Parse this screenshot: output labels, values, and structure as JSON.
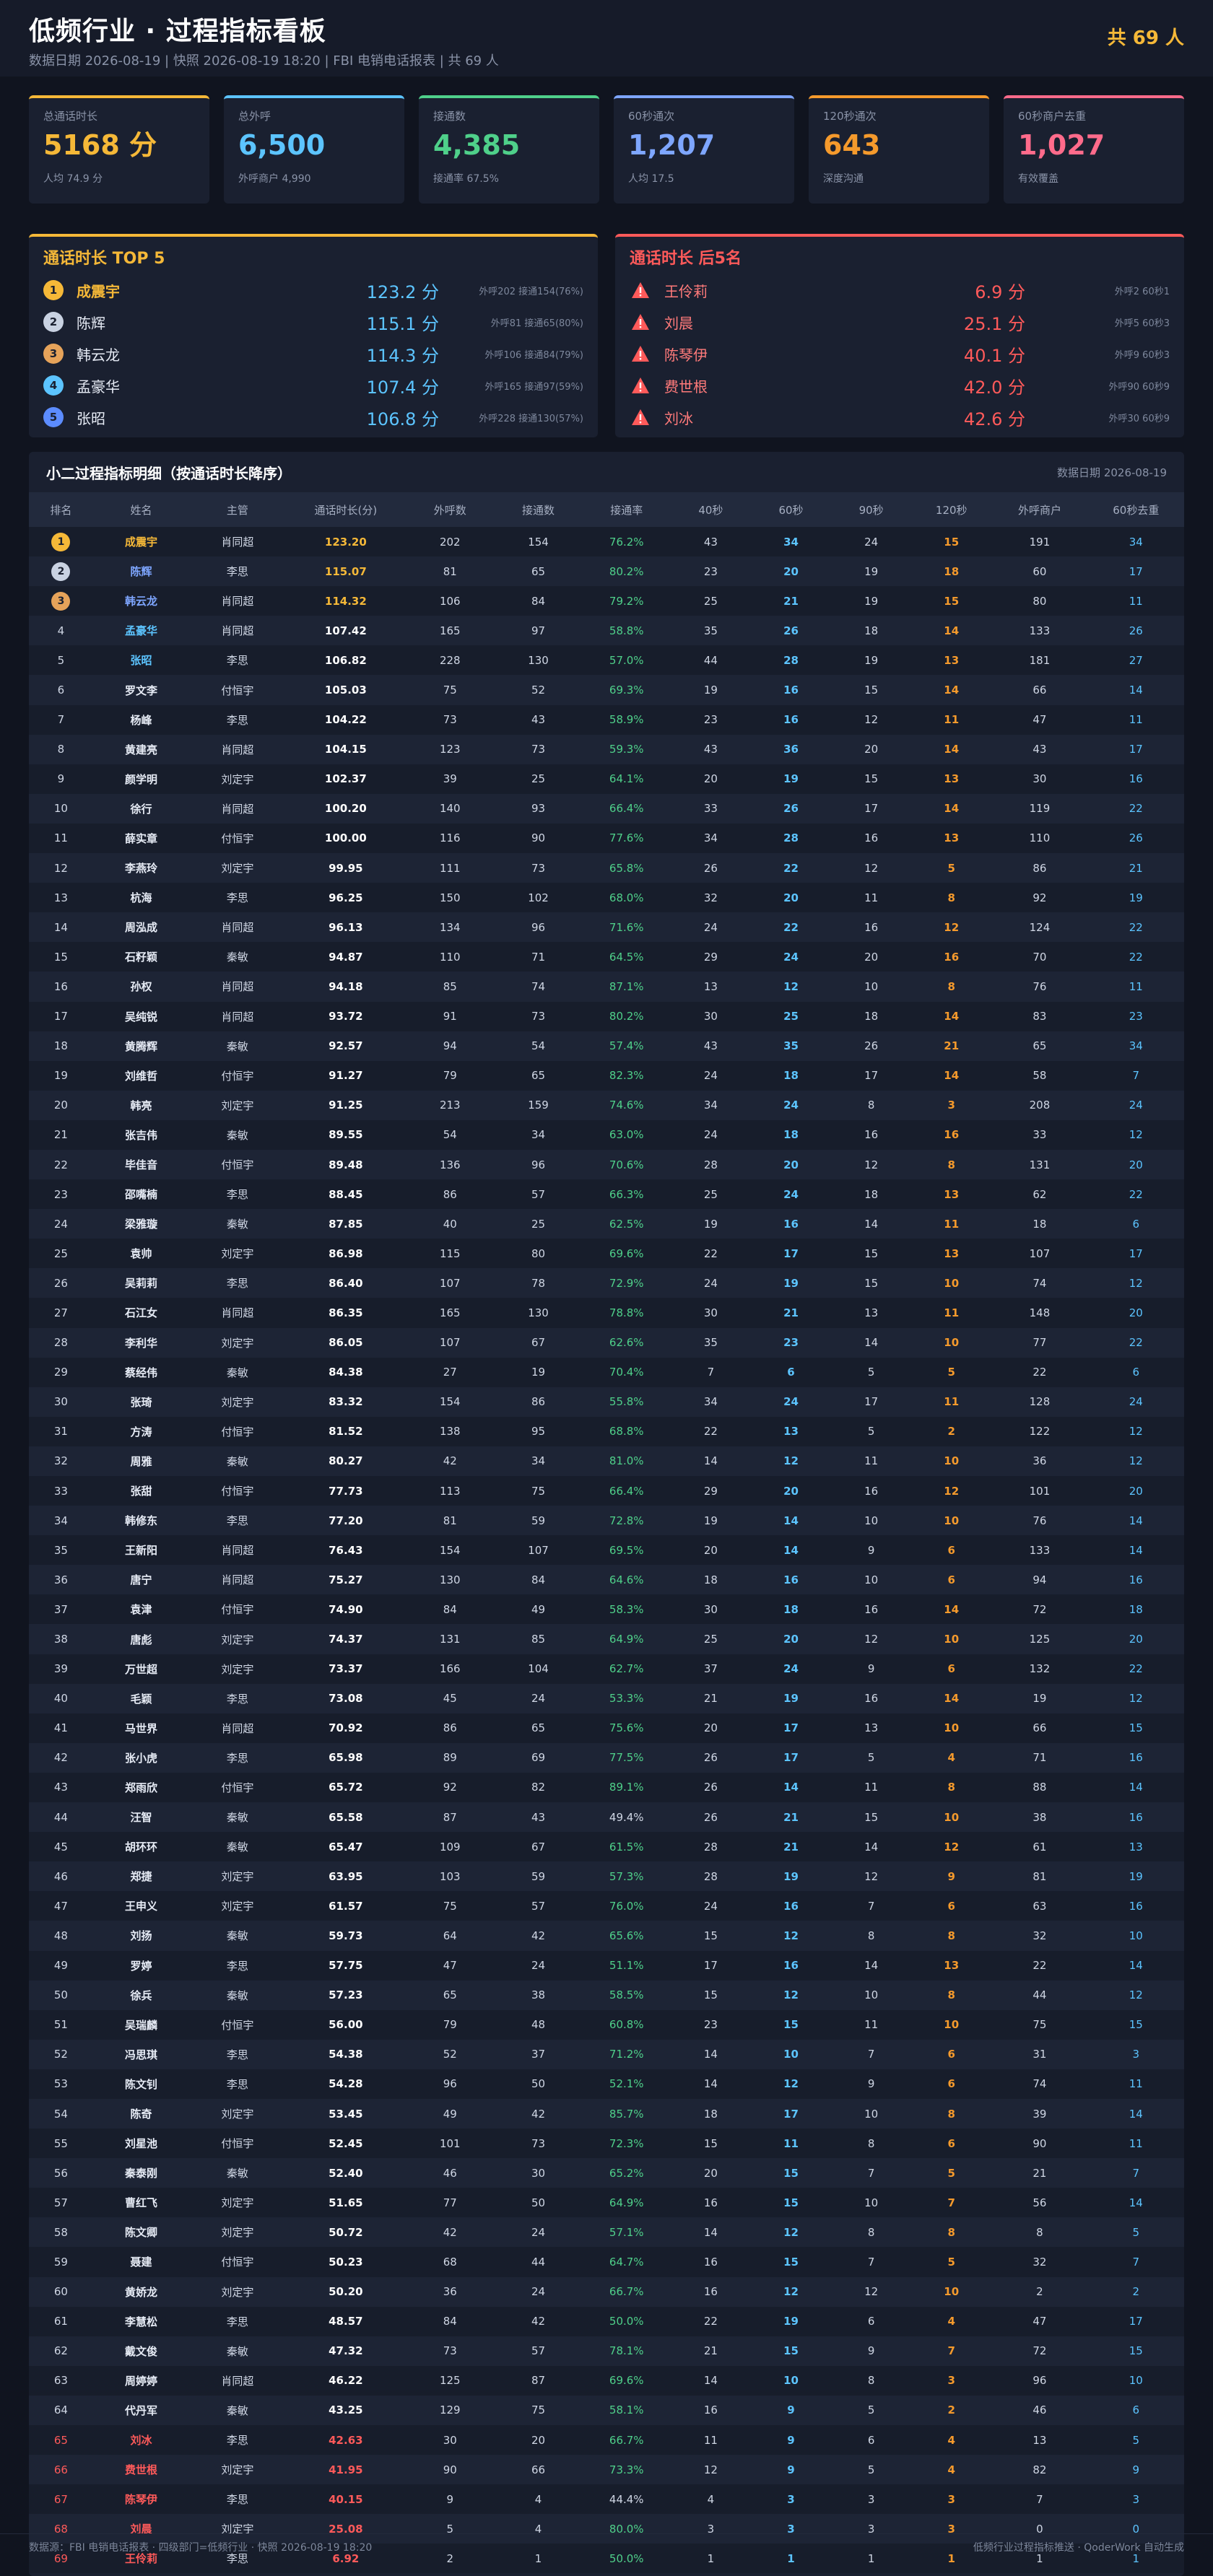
{
  "header": {
    "title": "低频行业 · 过程指标看板",
    "subtitle": "数据日期 2026-08-19 | 快照 2026-08-19 18:20 | FBI 电销电话报表 | 共 69 人",
    "total": "共 69 人"
  },
  "kpis": [
    {
      "label": "总通话时长",
      "value": "5168 分",
      "note": "人均 74.9 分",
      "color": "#f5b838"
    },
    {
      "label": "总外呼",
      "value": "6,500",
      "note": "外呼商户 4,990",
      "color": "#5cc4ff"
    },
    {
      "label": "接通数",
      "value": "4,385",
      "note": "接通率 67.5%",
      "color": "#4fd08a"
    },
    {
      "label": "60秒通次",
      "value": "1,207",
      "note": "人均 17.5",
      "color": "#7ea6ff"
    },
    {
      "label": "120秒通次",
      "value": "643",
      "note": "深度沟通",
      "color": "#f59a2c"
    },
    {
      "label": "60秒商户去重",
      "value": "1,027",
      "note": "有效覆盖",
      "color": "#ff6b8b"
    }
  ],
  "top5": {
    "title": "通话时长 TOP 5",
    "color": "#f5b838",
    "rows": [
      {
        "rank": "1",
        "name": "成震宇",
        "dur": "123.2 分",
        "extra": "外呼202 接通154(76%)",
        "badge": "#f5b838",
        "nameColor": "#f5b838"
      },
      {
        "rank": "2",
        "name": "陈辉",
        "dur": "115.1 分",
        "extra": "外呼81 接通65(80%)",
        "badge": "#c9d2e2",
        "nameColor": "#e6ebf5"
      },
      {
        "rank": "3",
        "name": "韩云龙",
        "dur": "114.3 分",
        "extra": "外呼106 接通84(79%)",
        "badge": "#e6a35a",
        "nameColor": "#e6ebf5"
      },
      {
        "rank": "4",
        "name": "孟豪华",
        "dur": "107.4 分",
        "extra": "外呼165 接通97(59%)",
        "badge": "#5cc4ff",
        "nameColor": "#e6ebf5"
      },
      {
        "rank": "5",
        "name": "张昭",
        "dur": "106.8 分",
        "extra": "外呼228 接通130(57%)",
        "badge": "#5c8cff",
        "nameColor": "#e6ebf5"
      }
    ]
  },
  "bottom5": {
    "title": "通话时长 后5名",
    "color": "#ff5a5a",
    "rows": [
      {
        "name": "王伶莉",
        "dur": "6.9 分",
        "extra": "外呼2 60秒1"
      },
      {
        "name": "刘晨",
        "dur": "25.1 分",
        "extra": "外呼5 60秒3"
      },
      {
        "name": "陈琴伊",
        "dur": "40.1 分",
        "extra": "外呼9 60秒3"
      },
      {
        "name": "费世根",
        "dur": "42.0 分",
        "extra": "外呼90 60秒9"
      },
      {
        "name": "刘冰",
        "dur": "42.6 分",
        "extra": "外呼30 60秒9"
      }
    ]
  },
  "table": {
    "title": "小二过程指标明细（按通话时长降序）",
    "date": "数据日期 2026-08-19",
    "columns": [
      "排名",
      "姓名",
      "主管",
      "通话时长(分)",
      "外呼数",
      "接通数",
      "接通率",
      "40秒",
      "60秒",
      "90秒",
      "120秒",
      "外呼商户",
      "60秒去重"
    ],
    "rows": [
      [
        "1",
        "成震宇",
        "肖同超",
        "123.20",
        "202",
        "154",
        "76.2%",
        "43",
        "34",
        "24",
        "15",
        "191",
        "34"
      ],
      [
        "2",
        "陈辉",
        "李思",
        "115.07",
        "81",
        "65",
        "80.2%",
        "23",
        "20",
        "19",
        "18",
        "60",
        "17"
      ],
      [
        "3",
        "韩云龙",
        "肖同超",
        "114.32",
        "106",
        "84",
        "79.2%",
        "25",
        "21",
        "19",
        "15",
        "80",
        "11"
      ],
      [
        "4",
        "孟豪华",
        "肖同超",
        "107.42",
        "165",
        "97",
        "58.8%",
        "35",
        "26",
        "18",
        "14",
        "133",
        "26"
      ],
      [
        "5",
        "张昭",
        "李思",
        "106.82",
        "228",
        "130",
        "57.0%",
        "44",
        "28",
        "19",
        "13",
        "181",
        "27"
      ],
      [
        "6",
        "罗文李",
        "付恒宇",
        "105.03",
        "75",
        "52",
        "69.3%",
        "19",
        "16",
        "15",
        "14",
        "66",
        "14"
      ],
      [
        "7",
        "杨峰",
        "李思",
        "104.22",
        "73",
        "43",
        "58.9%",
        "23",
        "16",
        "12",
        "11",
        "47",
        "11"
      ],
      [
        "8",
        "黄建亮",
        "肖同超",
        "104.15",
        "123",
        "73",
        "59.3%",
        "43",
        "36",
        "20",
        "14",
        "43",
        "17"
      ],
      [
        "9",
        "颜学明",
        "刘定宇",
        "102.37",
        "39",
        "25",
        "64.1%",
        "20",
        "19",
        "15",
        "13",
        "30",
        "16"
      ],
      [
        "10",
        "徐行",
        "肖同超",
        "100.20",
        "140",
        "93",
        "66.4%",
        "33",
        "26",
        "17",
        "14",
        "119",
        "22"
      ],
      [
        "11",
        "薛实章",
        "付恒宇",
        "100.00",
        "116",
        "90",
        "77.6%",
        "34",
        "28",
        "16",
        "13",
        "110",
        "26"
      ],
      [
        "12",
        "李燕玲",
        "刘定宇",
        "99.95",
        "111",
        "73",
        "65.8%",
        "26",
        "22",
        "12",
        "5",
        "86",
        "21"
      ],
      [
        "13",
        "杭海",
        "李思",
        "96.25",
        "150",
        "102",
        "68.0%",
        "32",
        "20",
        "11",
        "8",
        "92",
        "19"
      ],
      [
        "14",
        "周泓成",
        "肖同超",
        "96.13",
        "134",
        "96",
        "71.6%",
        "24",
        "22",
        "16",
        "12",
        "124",
        "22"
      ],
      [
        "15",
        "石籽颖",
        "秦敏",
        "94.87",
        "110",
        "71",
        "64.5%",
        "29",
        "24",
        "20",
        "16",
        "70",
        "22"
      ],
      [
        "16",
        "孙权",
        "肖同超",
        "94.18",
        "85",
        "74",
        "87.1%",
        "13",
        "12",
        "10",
        "8",
        "76",
        "11"
      ],
      [
        "17",
        "吴纯锐",
        "肖同超",
        "93.72",
        "91",
        "73",
        "80.2%",
        "30",
        "25",
        "18",
        "14",
        "83",
        "23"
      ],
      [
        "18",
        "黄腾辉",
        "秦敏",
        "92.57",
        "94",
        "54",
        "57.4%",
        "43",
        "35",
        "26",
        "21",
        "65",
        "34"
      ],
      [
        "19",
        "刘维哲",
        "付恒宇",
        "91.27",
        "79",
        "65",
        "82.3%",
        "24",
        "18",
        "17",
        "14",
        "58",
        "7"
      ],
      [
        "20",
        "韩亮",
        "刘定宇",
        "91.25",
        "213",
        "159",
        "74.6%",
        "34",
        "24",
        "8",
        "3",
        "208",
        "24"
      ],
      [
        "21",
        "张吉伟",
        "秦敏",
        "89.55",
        "54",
        "34",
        "63.0%",
        "24",
        "18",
        "16",
        "16",
        "33",
        "12"
      ],
      [
        "22",
        "毕佳音",
        "付恒宇",
        "89.48",
        "136",
        "96",
        "70.6%",
        "28",
        "20",
        "12",
        "8",
        "131",
        "20"
      ],
      [
        "23",
        "邵嘴楠",
        "李思",
        "88.45",
        "86",
        "57",
        "66.3%",
        "25",
        "24",
        "18",
        "13",
        "62",
        "22"
      ],
      [
        "24",
        "梁雅璇",
        "秦敏",
        "87.85",
        "40",
        "25",
        "62.5%",
        "19",
        "16",
        "14",
        "11",
        "18",
        "6"
      ],
      [
        "25",
        "袁帅",
        "刘定宇",
        "86.98",
        "115",
        "80",
        "69.6%",
        "22",
        "17",
        "15",
        "13",
        "107",
        "17"
      ],
      [
        "26",
        "吴莉莉",
        "李思",
        "86.40",
        "107",
        "78",
        "72.9%",
        "24",
        "19",
        "15",
        "10",
        "74",
        "12"
      ],
      [
        "27",
        "石江女",
        "肖同超",
        "86.35",
        "165",
        "130",
        "78.8%",
        "30",
        "21",
        "13",
        "11",
        "148",
        "20"
      ],
      [
        "28",
        "李利华",
        "刘定宇",
        "86.05",
        "107",
        "67",
        "62.6%",
        "35",
        "23",
        "14",
        "10",
        "77",
        "22"
      ],
      [
        "29",
        "蔡经伟",
        "秦敏",
        "84.38",
        "27",
        "19",
        "70.4%",
        "7",
        "6",
        "5",
        "5",
        "22",
        "6"
      ],
      [
        "30",
        "张琦",
        "刘定宇",
        "83.32",
        "154",
        "86",
        "55.8%",
        "34",
        "24",
        "17",
        "11",
        "128",
        "24"
      ],
      [
        "31",
        "方涛",
        "付恒宇",
        "81.52",
        "138",
        "95",
        "68.8%",
        "22",
        "13",
        "5",
        "2",
        "122",
        "12"
      ],
      [
        "32",
        "周雅",
        "秦敏",
        "80.27",
        "42",
        "34",
        "81.0%",
        "14",
        "12",
        "11",
        "10",
        "36",
        "12"
      ],
      [
        "33",
        "张甜",
        "付恒宇",
        "77.73",
        "113",
        "75",
        "66.4%",
        "29",
        "20",
        "16",
        "12",
        "101",
        "20"
      ],
      [
        "34",
        "韩修东",
        "李思",
        "77.20",
        "81",
        "59",
        "72.8%",
        "19",
        "14",
        "10",
        "10",
        "76",
        "14"
      ],
      [
        "35",
        "王新阳",
        "肖同超",
        "76.43",
        "154",
        "107",
        "69.5%",
        "20",
        "14",
        "9",
        "6",
        "133",
        "14"
      ],
      [
        "36",
        "唐宁",
        "肖同超",
        "75.27",
        "130",
        "84",
        "64.6%",
        "18",
        "16",
        "10",
        "6",
        "94",
        "16"
      ],
      [
        "37",
        "袁津",
        "付恒宇",
        "74.90",
        "84",
        "49",
        "58.3%",
        "30",
        "18",
        "16",
        "14",
        "72",
        "18"
      ],
      [
        "38",
        "唐彪",
        "刘定宇",
        "74.37",
        "131",
        "85",
        "64.9%",
        "25",
        "20",
        "12",
        "10",
        "125",
        "20"
      ],
      [
        "39",
        "万世超",
        "刘定宇",
        "73.37",
        "166",
        "104",
        "62.7%",
        "37",
        "24",
        "9",
        "6",
        "132",
        "22"
      ],
      [
        "40",
        "毛颖",
        "李思",
        "73.08",
        "45",
        "24",
        "53.3%",
        "21",
        "19",
        "16",
        "14",
        "19",
        "12"
      ],
      [
        "41",
        "马世界",
        "肖同超",
        "70.92",
        "86",
        "65",
        "75.6%",
        "20",
        "17",
        "13",
        "10",
        "66",
        "15"
      ],
      [
        "42",
        "张小虎",
        "李思",
        "65.98",
        "89",
        "69",
        "77.5%",
        "26",
        "17",
        "5",
        "4",
        "71",
        "16"
      ],
      [
        "43",
        "郑雨欣",
        "付恒宇",
        "65.72",
        "92",
        "82",
        "89.1%",
        "26",
        "14",
        "11",
        "8",
        "88",
        "14"
      ],
      [
        "44",
        "汪智",
        "秦敏",
        "65.58",
        "87",
        "43",
        "49.4%",
        "26",
        "21",
        "15",
        "10",
        "38",
        "16"
      ],
      [
        "45",
        "胡环环",
        "秦敏",
        "65.47",
        "109",
        "67",
        "61.5%",
        "28",
        "21",
        "14",
        "12",
        "61",
        "13"
      ],
      [
        "46",
        "郑捷",
        "刘定宇",
        "63.95",
        "103",
        "59",
        "57.3%",
        "28",
        "19",
        "12",
        "9",
        "81",
        "19"
      ],
      [
        "47",
        "王申义",
        "刘定宇",
        "61.57",
        "75",
        "57",
        "76.0%",
        "24",
        "16",
        "7",
        "6",
        "63",
        "16"
      ],
      [
        "48",
        "刘扬",
        "秦敏",
        "59.73",
        "64",
        "42",
        "65.6%",
        "15",
        "12",
        "8",
        "8",
        "32",
        "10"
      ],
      [
        "49",
        "罗婷",
        "李思",
        "57.75",
        "47",
        "24",
        "51.1%",
        "17",
        "16",
        "14",
        "13",
        "22",
        "14"
      ],
      [
        "50",
        "徐兵",
        "秦敏",
        "57.23",
        "65",
        "38",
        "58.5%",
        "15",
        "12",
        "10",
        "8",
        "44",
        "12"
      ],
      [
        "51",
        "吴瑞麟",
        "付恒宇",
        "56.00",
        "79",
        "48",
        "60.8%",
        "23",
        "15",
        "11",
        "10",
        "75",
        "15"
      ],
      [
        "52",
        "冯思琪",
        "李思",
        "54.38",
        "52",
        "37",
        "71.2%",
        "14",
        "10",
        "7",
        "6",
        "31",
        "3"
      ],
      [
        "53",
        "陈文钊",
        "李思",
        "54.28",
        "96",
        "50",
        "52.1%",
        "14",
        "12",
        "9",
        "6",
        "74",
        "11"
      ],
      [
        "54",
        "陈奇",
        "刘定宇",
        "53.45",
        "49",
        "42",
        "85.7%",
        "18",
        "17",
        "10",
        "8",
        "39",
        "14"
      ],
      [
        "55",
        "刘星池",
        "付恒宇",
        "52.45",
        "101",
        "73",
        "72.3%",
        "15",
        "11",
        "8",
        "6",
        "90",
        "11"
      ],
      [
        "56",
        "秦泰刚",
        "秦敏",
        "52.40",
        "46",
        "30",
        "65.2%",
        "20",
        "15",
        "7",
        "5",
        "21",
        "7"
      ],
      [
        "57",
        "曹红飞",
        "刘定宇",
        "51.65",
        "77",
        "50",
        "64.9%",
        "16",
        "15",
        "10",
        "7",
        "56",
        "14"
      ],
      [
        "58",
        "陈文卿",
        "刘定宇",
        "50.72",
        "42",
        "24",
        "57.1%",
        "14",
        "12",
        "8",
        "8",
        "8",
        "5"
      ],
      [
        "59",
        "聂建",
        "付恒宇",
        "50.23",
        "68",
        "44",
        "64.7%",
        "16",
        "15",
        "7",
        "5",
        "32",
        "7"
      ],
      [
        "60",
        "黄娇龙",
        "刘定宇",
        "50.20",
        "36",
        "24",
        "66.7%",
        "16",
        "12",
        "12",
        "10",
        "2",
        "2"
      ],
      [
        "61",
        "李慧松",
        "李思",
        "48.57",
        "84",
        "42",
        "50.0%",
        "22",
        "19",
        "6",
        "4",
        "47",
        "17"
      ],
      [
        "62",
        "戴文俊",
        "秦敏",
        "47.32",
        "73",
        "57",
        "78.1%",
        "21",
        "15",
        "9",
        "7",
        "72",
        "15"
      ],
      [
        "63",
        "周婷婷",
        "肖同超",
        "46.22",
        "125",
        "87",
        "69.6%",
        "14",
        "10",
        "8",
        "3",
        "96",
        "10"
      ],
      [
        "64",
        "代丹军",
        "秦敏",
        "43.25",
        "129",
        "75",
        "58.1%",
        "16",
        "9",
        "5",
        "2",
        "46",
        "6"
      ],
      [
        "65",
        "刘冰",
        "李思",
        "42.63",
        "30",
        "20",
        "66.7%",
        "11",
        "9",
        "6",
        "4",
        "13",
        "5"
      ],
      [
        "66",
        "费世根",
        "刘定宇",
        "41.95",
        "90",
        "66",
        "73.3%",
        "12",
        "9",
        "5",
        "4",
        "82",
        "9"
      ],
      [
        "67",
        "陈琴伊",
        "李思",
        "40.15",
        "9",
        "4",
        "44.4%",
        "4",
        "3",
        "3",
        "3",
        "7",
        "3"
      ],
      [
        "68",
        "刘晨",
        "刘定宇",
        "25.08",
        "5",
        "4",
        "80.0%",
        "3",
        "3",
        "3",
        "3",
        "0",
        "0"
      ],
      [
        "69",
        "王伶莉",
        "李思",
        "6.92",
        "2",
        "1",
        "50.0%",
        "1",
        "1",
        "1",
        "1",
        "1",
        "1"
      ]
    ]
  },
  "footer": {
    "left": "数据源：FBI 电销电话报表 · 四级部门=低频行业 · 快照 2026-08-19 18:20",
    "right": "低频行业过程指标推送 · QoderWork 自动生成"
  }
}
